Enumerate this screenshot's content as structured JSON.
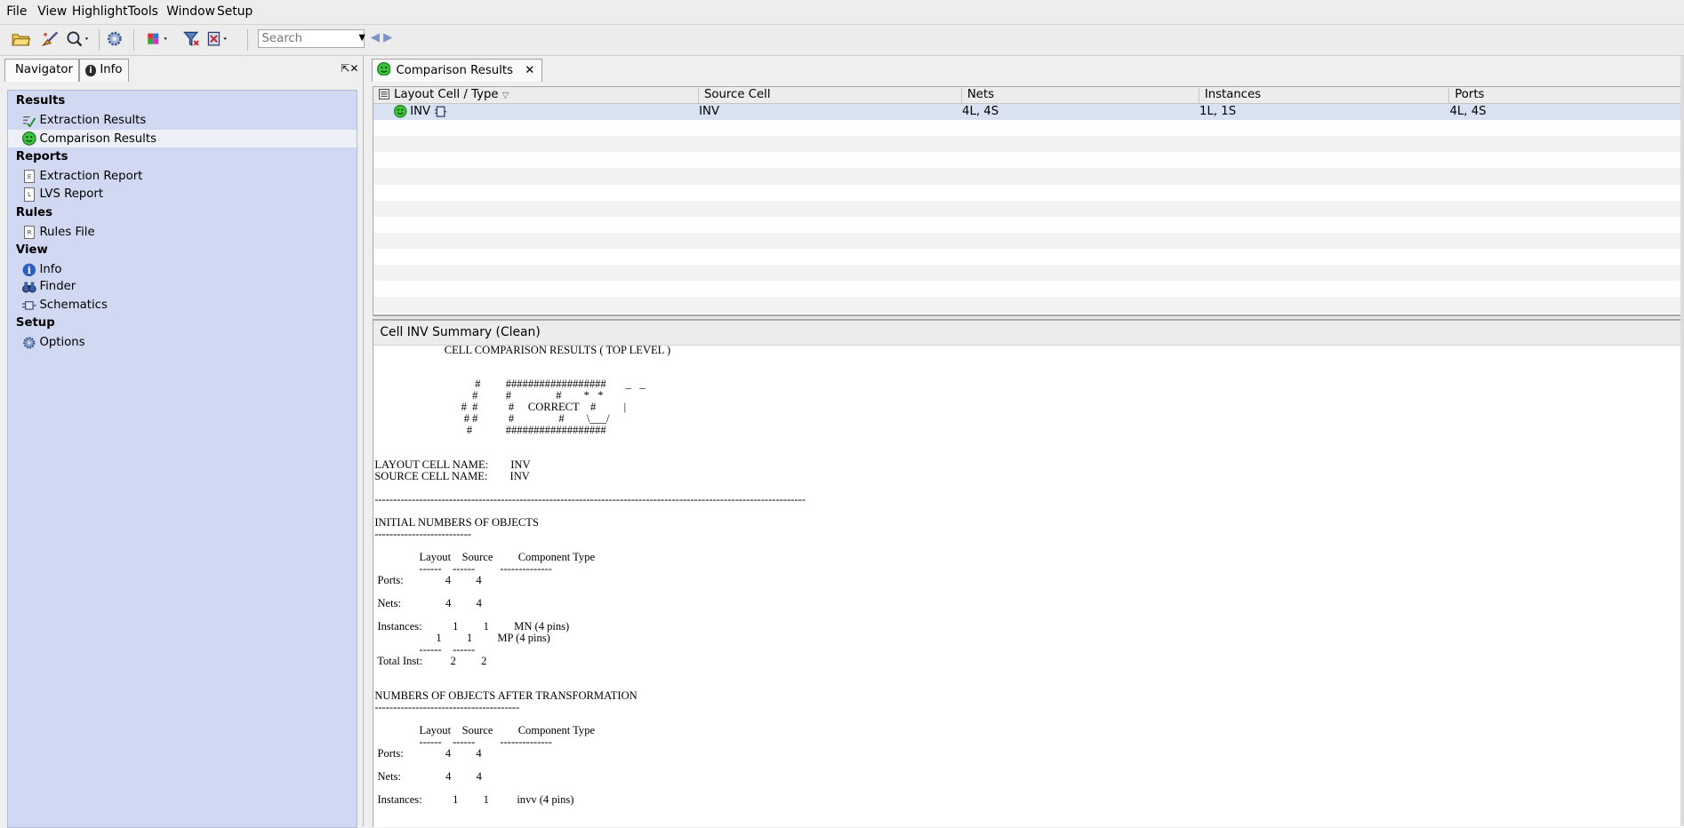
{
  "menubar": {
    "items": [
      "File",
      "View",
      "Highlight",
      "Tools",
      "Window",
      "Setup"
    ]
  },
  "toolbar": {
    "search_placeholder": "Search",
    "icons": [
      "open-folder-icon",
      "brush-icon",
      "zoom-icon",
      "gear-icon",
      "highlight-color-icon",
      "filter-icon",
      "clear-highlight-icon"
    ]
  },
  "left_panel": {
    "tabs": [
      "Navigator",
      "Info"
    ],
    "sections": [
      {
        "title": "Results",
        "items": [
          "Extraction Results",
          "Comparison Results"
        ]
      },
      {
        "title": "Reports",
        "items": [
          "Extraction Report",
          "LVS Report"
        ]
      },
      {
        "title": "Rules",
        "items": [
          "Rules File"
        ]
      },
      {
        "title": "View",
        "items": [
          "Info",
          "Finder",
          "Schematics"
        ]
      },
      {
        "title": "Setup",
        "items": [
          "Options"
        ]
      }
    ]
  },
  "right_panel": {
    "tab_label": "Comparison Results",
    "columns": [
      "Layout Cell / Type",
      "Source Cell",
      "Nets",
      "Instances",
      "Ports"
    ],
    "rows": [
      {
        "layout_cell": "INV",
        "source_cell": "INV",
        "nets": "4L, 4S",
        "instances": "1L, 1S",
        "ports": "4L, 4S",
        "status": "clean"
      }
    ],
    "summary_title": "Cell INV Summary (Clean)",
    "report": {
      "title": "CELL COMPARISON RESULTS ( TOP LEVEL )",
      "banner": [
        "                                    #         ##################       _   _",
        "                                   #          #                #        *   *",
        "                               #  #           #     CORRECT    #          |",
        "                                # #           #                #        \\___/",
        "                                 #            ##################"
      ],
      "layout_cell_name_label": "LAYOUT CELL NAME:",
      "layout_cell_name": "INV",
      "source_cell_name_label": "SOURCE CELL NAME:",
      "source_cell_name": "INV",
      "section1_title": "INITIAL NUMBERS OF OBJECTS",
      "section2_title": "NUMBERS OF OBJECTS AFTER TRANSFORMATION",
      "col_layout": "Layout",
      "col_source": "Source",
      "col_type": "Component Type",
      "s1": {
        "ports": [
          "4",
          "4"
        ],
        "nets": [
          "4",
          "4"
        ],
        "instances": [
          [
            "1",
            "1",
            "MN (4 pins)"
          ],
          [
            "1",
            "1",
            "MP (4 pins)"
          ]
        ],
        "total": [
          "2",
          "2"
        ]
      },
      "s2": {
        "ports": [
          "4",
          "4"
        ],
        "nets": [
          "4",
          "4"
        ],
        "instances": [
          [
            "1",
            "1",
            "invv (4 pins)"
          ]
        ]
      }
    }
  }
}
